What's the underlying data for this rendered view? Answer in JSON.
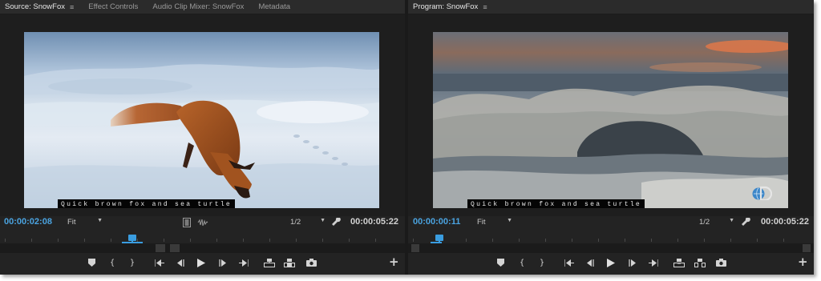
{
  "source": {
    "tabs": [
      {
        "label": "Source: SnowFox",
        "active": true,
        "has_menu": true
      },
      {
        "label": "Effect Controls",
        "active": false
      },
      {
        "label": "Audio Clip Mixer: SnowFox",
        "active": false
      },
      {
        "label": "Metadata",
        "active": false
      }
    ],
    "caption": "Quick brown fox and sea turtle",
    "current_timecode": "00:00:02:08",
    "duration_timecode": "00:00:05:22",
    "zoom": "Fit",
    "resolution": "1/2"
  },
  "program": {
    "tab": {
      "label": "Program: SnowFox",
      "active": true,
      "has_menu": true
    },
    "caption": "Quick brown fox and sea turtle",
    "current_timecode": "00:00:00:11",
    "duration_timecode": "00:00:05:22",
    "zoom": "Fit",
    "resolution": "1/2"
  },
  "menu_glyph": "≡",
  "colors": {
    "panel_bg": "#232323",
    "timecode_accent": "#4aa3e0",
    "playhead": "#3a9de0"
  },
  "icons": {
    "source_transport": [
      "marker-icon",
      "mark-in-icon",
      "mark-out-icon",
      "go-to-in-icon",
      "step-back-icon",
      "play-icon",
      "step-forward-icon",
      "go-to-out-icon",
      "insert-icon",
      "overwrite-icon",
      "export-frame-icon",
      "add-button-icon"
    ],
    "program_transport": [
      "marker-icon",
      "mark-in-icon",
      "mark-out-icon",
      "go-to-in-icon",
      "step-back-icon",
      "play-icon",
      "step-forward-icon",
      "go-to-out-icon",
      "lift-icon",
      "extract-icon",
      "export-frame-icon",
      "add-button-icon"
    ]
  }
}
